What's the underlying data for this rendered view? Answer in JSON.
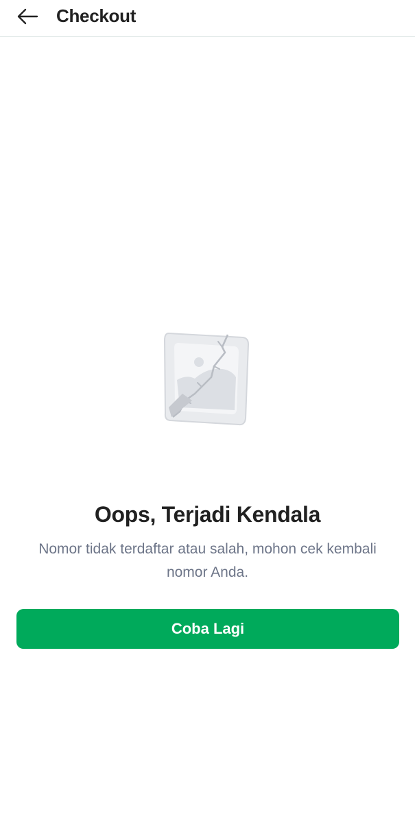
{
  "header": {
    "back_icon": "arrow-left-icon",
    "title": "Checkout"
  },
  "error": {
    "illustration_icon": "broken-image-icon",
    "title": "Oops, Terjadi Kendala",
    "message": "Nomor tidak terdaftar atau salah, mohon cek kembali nomor Anda."
  },
  "actions": {
    "retry_label": "Coba Lagi"
  },
  "colors": {
    "primary": "#00aa5b",
    "title_text": "#212121",
    "secondary_text": "#6d7588",
    "divider": "#dfe7e6"
  }
}
